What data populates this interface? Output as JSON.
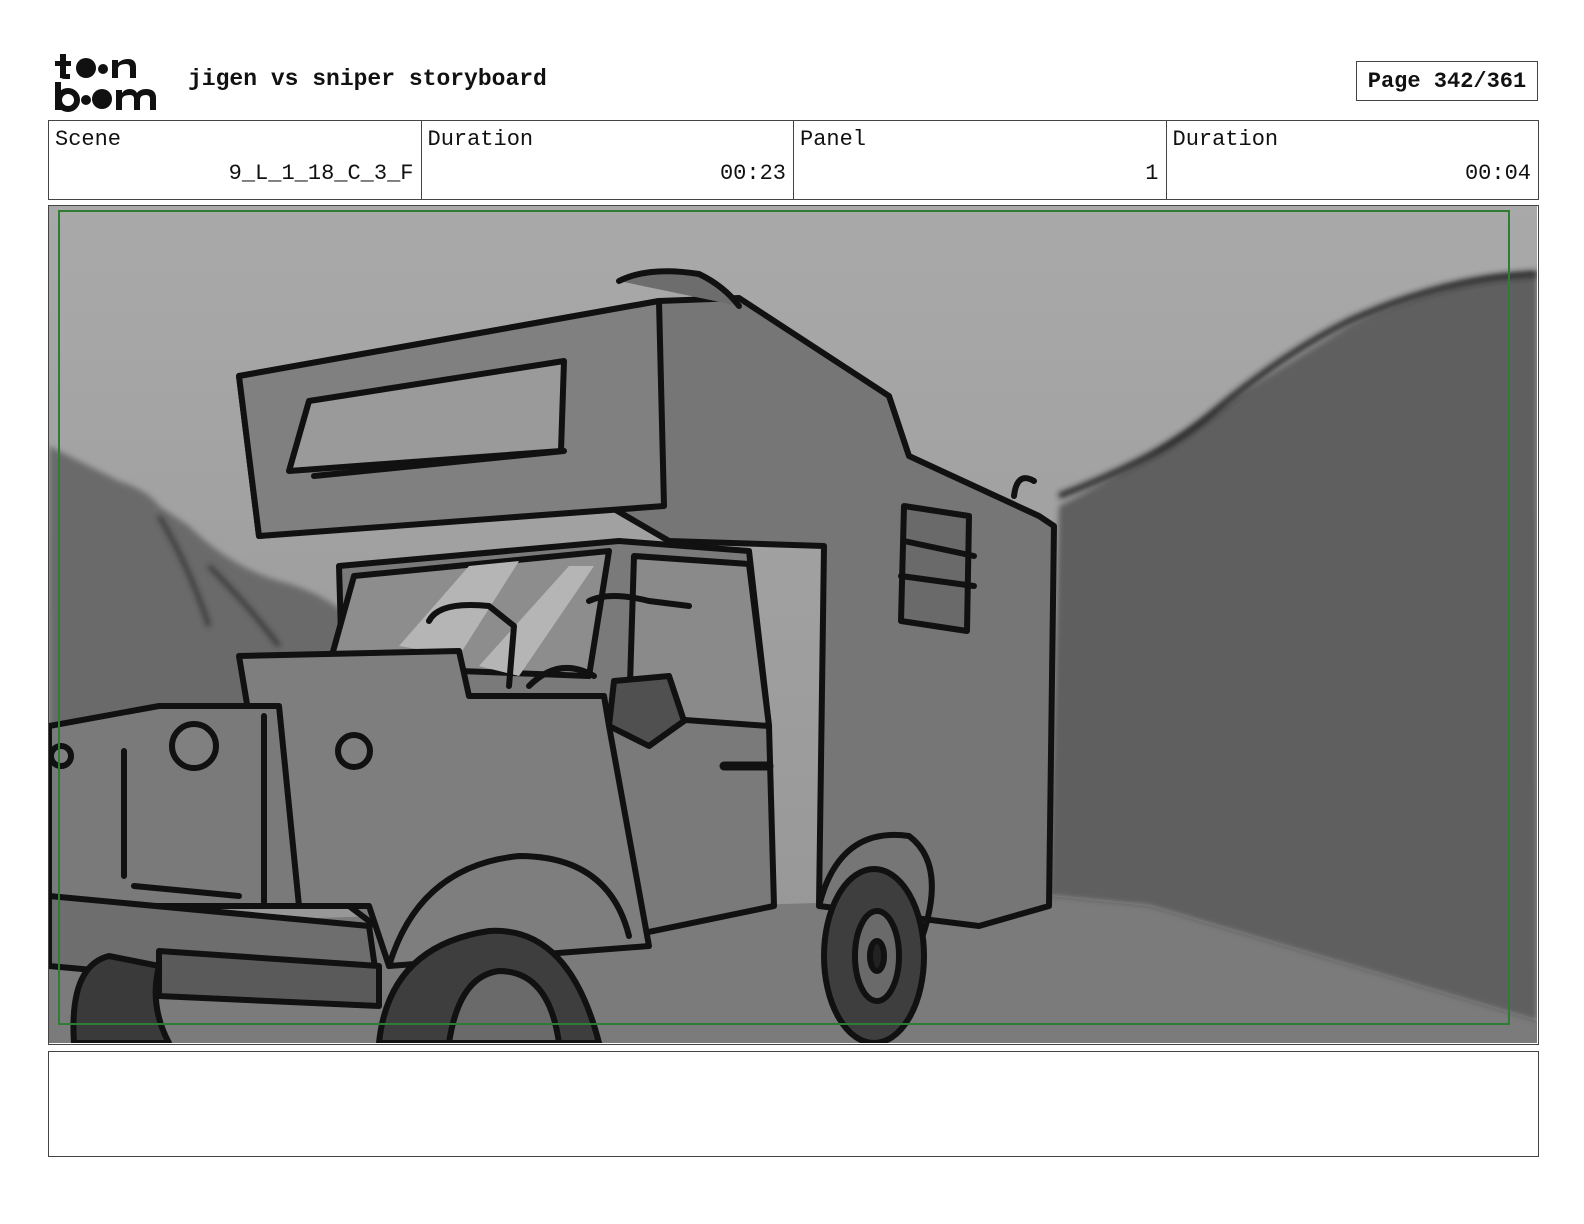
{
  "header": {
    "logo": {
      "line1": "to●n",
      "line2": "b●●m"
    },
    "title": "jigen vs sniper storyboard",
    "page_label": "Page 342/361"
  },
  "info": {
    "scene_label": "Scene",
    "scene_value": "9_L_1_18_C_3_F",
    "scene_duration_label": "Duration",
    "scene_duration_value": "00:23",
    "panel_label": "Panel",
    "panel_value": "1",
    "panel_duration_label": "Duration",
    "panel_duration_value": "00:04"
  },
  "panel": {
    "safe_frame_color": "#2e7d32",
    "background_color": "#9a9a9a"
  },
  "notes": {
    "text": ""
  }
}
